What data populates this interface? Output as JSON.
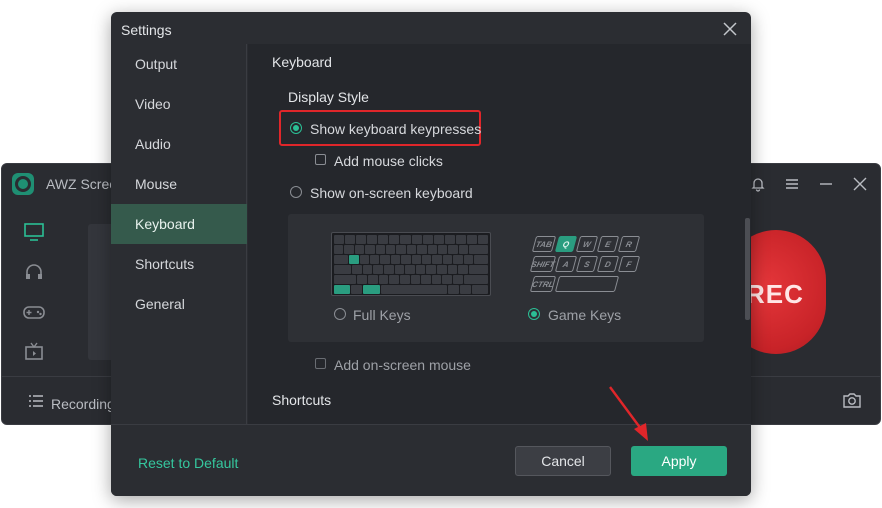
{
  "app": {
    "title": "AWZ Scree",
    "recording_list_label": "Recording",
    "rec_button_label": "REC"
  },
  "dialog": {
    "title": "Settings",
    "nav": [
      {
        "label": "Output"
      },
      {
        "label": "Video"
      },
      {
        "label": "Audio"
      },
      {
        "label": "Mouse"
      },
      {
        "label": "Keyboard",
        "active": true
      },
      {
        "label": "Shortcuts"
      },
      {
        "label": "General"
      }
    ],
    "content": {
      "section_keyboard": "Keyboard",
      "display_style_label": "Display Style",
      "opt_show_keypresses": "Show keyboard keypresses",
      "opt_add_mouse_clicks": "Add mouse clicks",
      "opt_show_onscreen_keyboard": "Show on-screen keyboard",
      "opt_full_keys": "Full Keys",
      "opt_game_keys": "Game Keys",
      "opt_add_onscreen_mouse": "Add on-screen mouse",
      "section_shortcuts": "Shortcuts",
      "game_keys": {
        "row1": [
          "TAB",
          "Q",
          "W",
          "E",
          "R"
        ],
        "row2": [
          "SHIFT",
          "A",
          "S",
          "D",
          "F"
        ],
        "row3": [
          "CTRL"
        ]
      }
    },
    "footer": {
      "reset_label": "Reset to Default",
      "cancel_label": "Cancel",
      "apply_label": "Apply"
    }
  },
  "colors": {
    "accent": "#2aa882",
    "highlight": "#e0262a",
    "rec_red": "#d0282c"
  }
}
